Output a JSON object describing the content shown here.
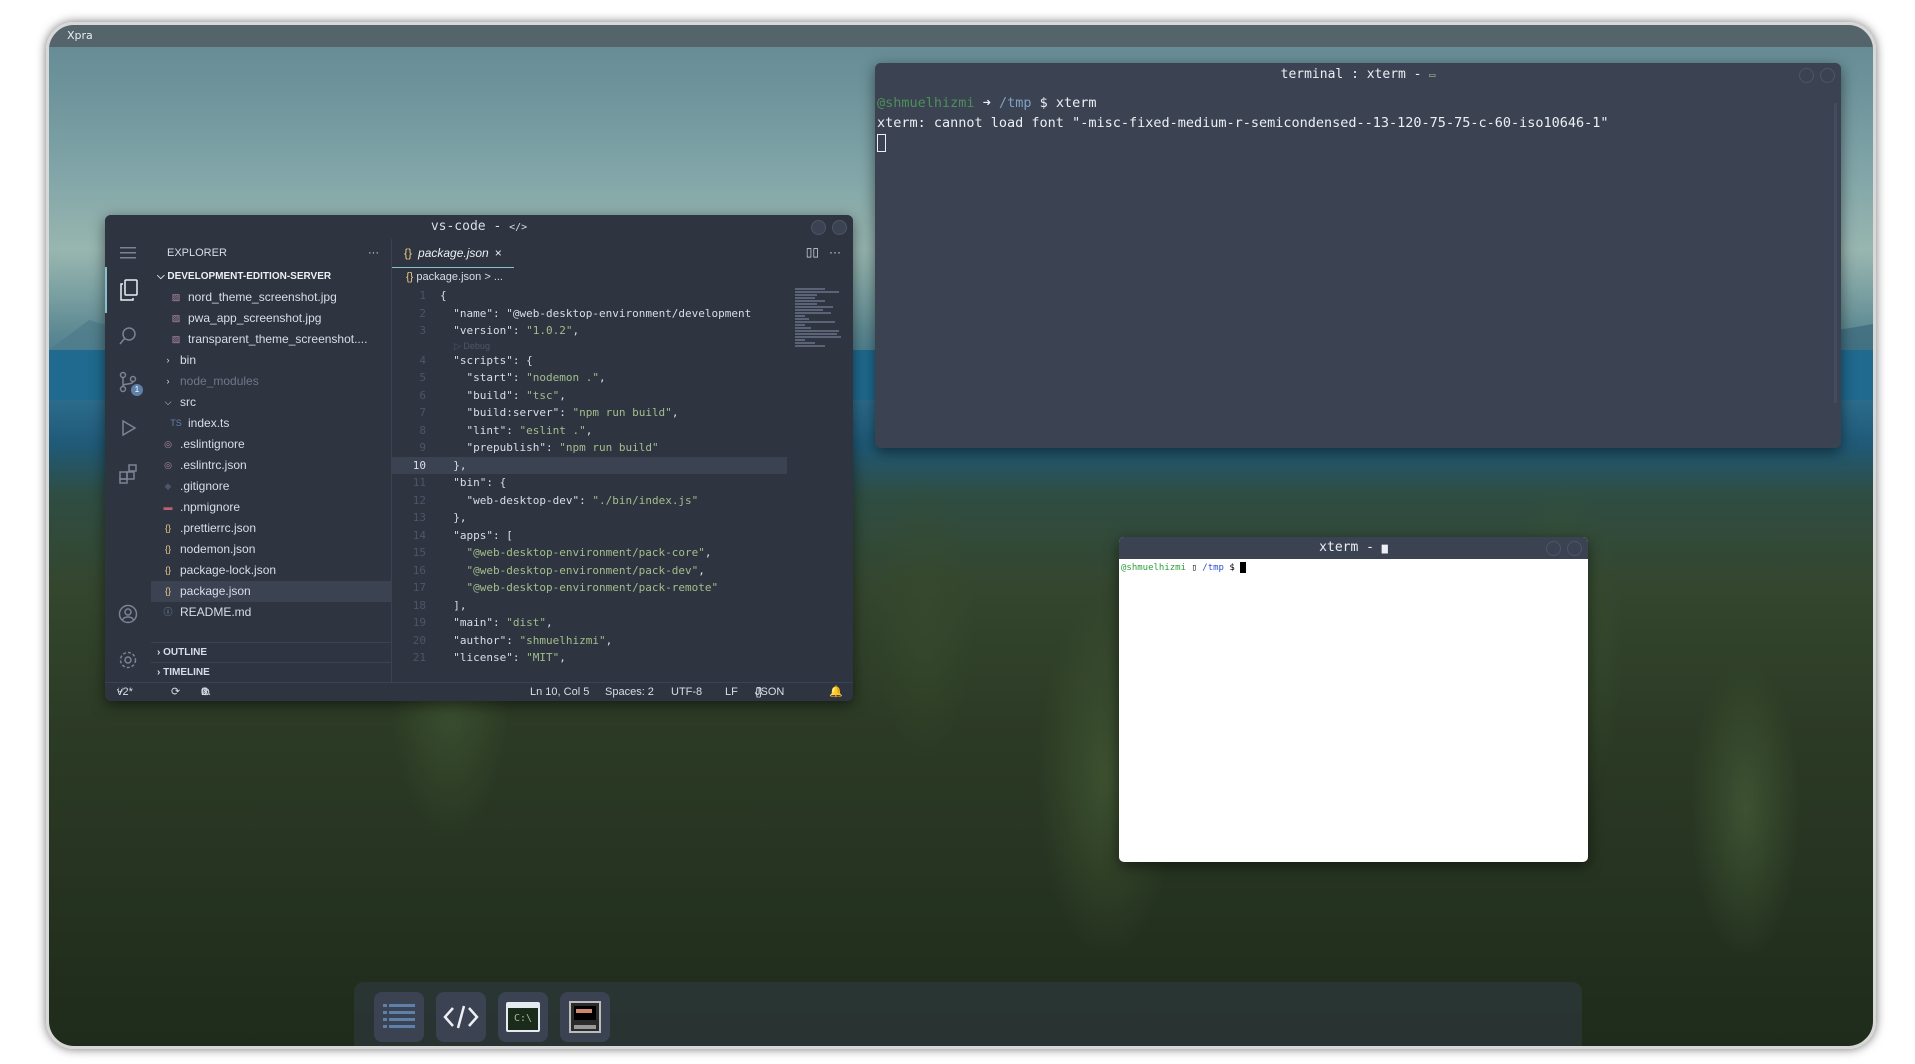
{
  "desktop": {
    "host_title": "Xpra"
  },
  "vscode": {
    "window_title": "vs-code -",
    "explorer": {
      "header": "EXPLORER",
      "more": "···",
      "root": "DEVELOPMENT-EDITION-SERVER",
      "items": [
        {
          "label": "nord_theme_screenshot.jpg",
          "icon": "image-icon",
          "indent": 2
        },
        {
          "label": "pwa_app_screenshot.jpg",
          "icon": "image-icon",
          "indent": 2
        },
        {
          "label": "transparent_theme_screenshot....",
          "icon": "image-icon",
          "indent": 2
        },
        {
          "label": "bin",
          "icon": "chevron-right-icon",
          "indent": 1
        },
        {
          "label": "node_modules",
          "icon": "chevron-right-icon",
          "indent": 1,
          "dim": true
        },
        {
          "label": "src",
          "icon": "chevron-down-icon",
          "indent": 1
        },
        {
          "label": "index.ts",
          "icon": "ts-icon",
          "indent": 2
        },
        {
          "label": ".eslintignore",
          "icon": "eslint-icon",
          "indent": 1
        },
        {
          "label": ".eslintrc.json",
          "icon": "eslint-icon",
          "indent": 1
        },
        {
          "label": ".gitignore",
          "icon": "git-icon",
          "indent": 1
        },
        {
          "label": ".npmignore",
          "icon": "npm-icon",
          "indent": 1
        },
        {
          "label": ".prettierrc.json",
          "icon": "json-icon",
          "indent": 1
        },
        {
          "label": "nodemon.json",
          "icon": "json-icon",
          "indent": 1
        },
        {
          "label": "package-lock.json",
          "icon": "json-icon",
          "indent": 1
        },
        {
          "label": "package.json",
          "icon": "json-icon",
          "indent": 1,
          "selected": true
        },
        {
          "label": "README.md",
          "icon": "info-icon",
          "indent": 1
        }
      ],
      "outline": "OUTLINE",
      "timeline": "TIMELINE"
    },
    "tab": {
      "label": "package.json",
      "icon": "{}",
      "close": "×"
    },
    "breadcrumb": {
      "file": "package.json",
      "sep": ">",
      "more": "..."
    },
    "codelens": "▷ Debug",
    "code": [
      {
        "n": "1",
        "t": "{"
      },
      {
        "n": "2",
        "t": "  \"name\": \"@web-desktop-environment/development"
      },
      {
        "n": "3",
        "t": "  \"version\": \"1.0.2\","
      },
      {
        "n": "4",
        "t": "  \"scripts\": {"
      },
      {
        "n": "5",
        "t": "    \"start\": \"nodemon .\","
      },
      {
        "n": "6",
        "t": "    \"build\": \"tsc\","
      },
      {
        "n": "7",
        "t": "    \"build:server\": \"npm run build\","
      },
      {
        "n": "8",
        "t": "    \"lint\": \"eslint .\","
      },
      {
        "n": "9",
        "t": "    \"prepublish\": \"npm run build\""
      },
      {
        "n": "10",
        "t": "  },"
      },
      {
        "n": "11",
        "t": "  \"bin\": {"
      },
      {
        "n": "12",
        "t": "    \"web-desktop-dev\": \"./bin/index.js\""
      },
      {
        "n": "13",
        "t": "  },"
      },
      {
        "n": "14",
        "t": "  \"apps\": ["
      },
      {
        "n": "15",
        "t": "    \"@web-desktop-environment/pack-core\","
      },
      {
        "n": "16",
        "t": "    \"@web-desktop-environment/pack-dev\","
      },
      {
        "n": "17",
        "t": "    \"@web-desktop-environment/pack-remote\""
      },
      {
        "n": "18",
        "t": "  ],"
      },
      {
        "n": "19",
        "t": "  \"main\": \"dist\","
      },
      {
        "n": "20",
        "t": "  \"author\": \"shmuelhizmi\","
      },
      {
        "n": "21",
        "t": "  \"license\": \"MIT\","
      }
    ],
    "status": {
      "branch": "v2*",
      "errors": "0",
      "warnings": "0",
      "position": "Ln 10, Col 5",
      "spaces": "Spaces: 2",
      "encoding": "UTF-8",
      "eol": "LF",
      "language": "JSON"
    }
  },
  "terminal1": {
    "title": "terminal : xterm -",
    "user": "@shmuelhizmi",
    "arrow": "➜",
    "cwd": "/tmp",
    "prompt": "$",
    "command": "xterm",
    "error": "xterm: cannot load font \"-misc-fixed-medium-r-semicondensed--13-120-75-75-c-60-iso10646-1\""
  },
  "terminal2": {
    "title": "xterm -",
    "user": "@shmuelhizmi",
    "cwd": "/tmp",
    "prompt": "$"
  },
  "dock": {
    "items": [
      {
        "name": "explorer-app-icon"
      },
      {
        "name": "vscode-app-icon"
      },
      {
        "name": "terminal-app-icon",
        "text": "C:\\"
      },
      {
        "name": "xterm-app-icon"
      }
    ]
  }
}
